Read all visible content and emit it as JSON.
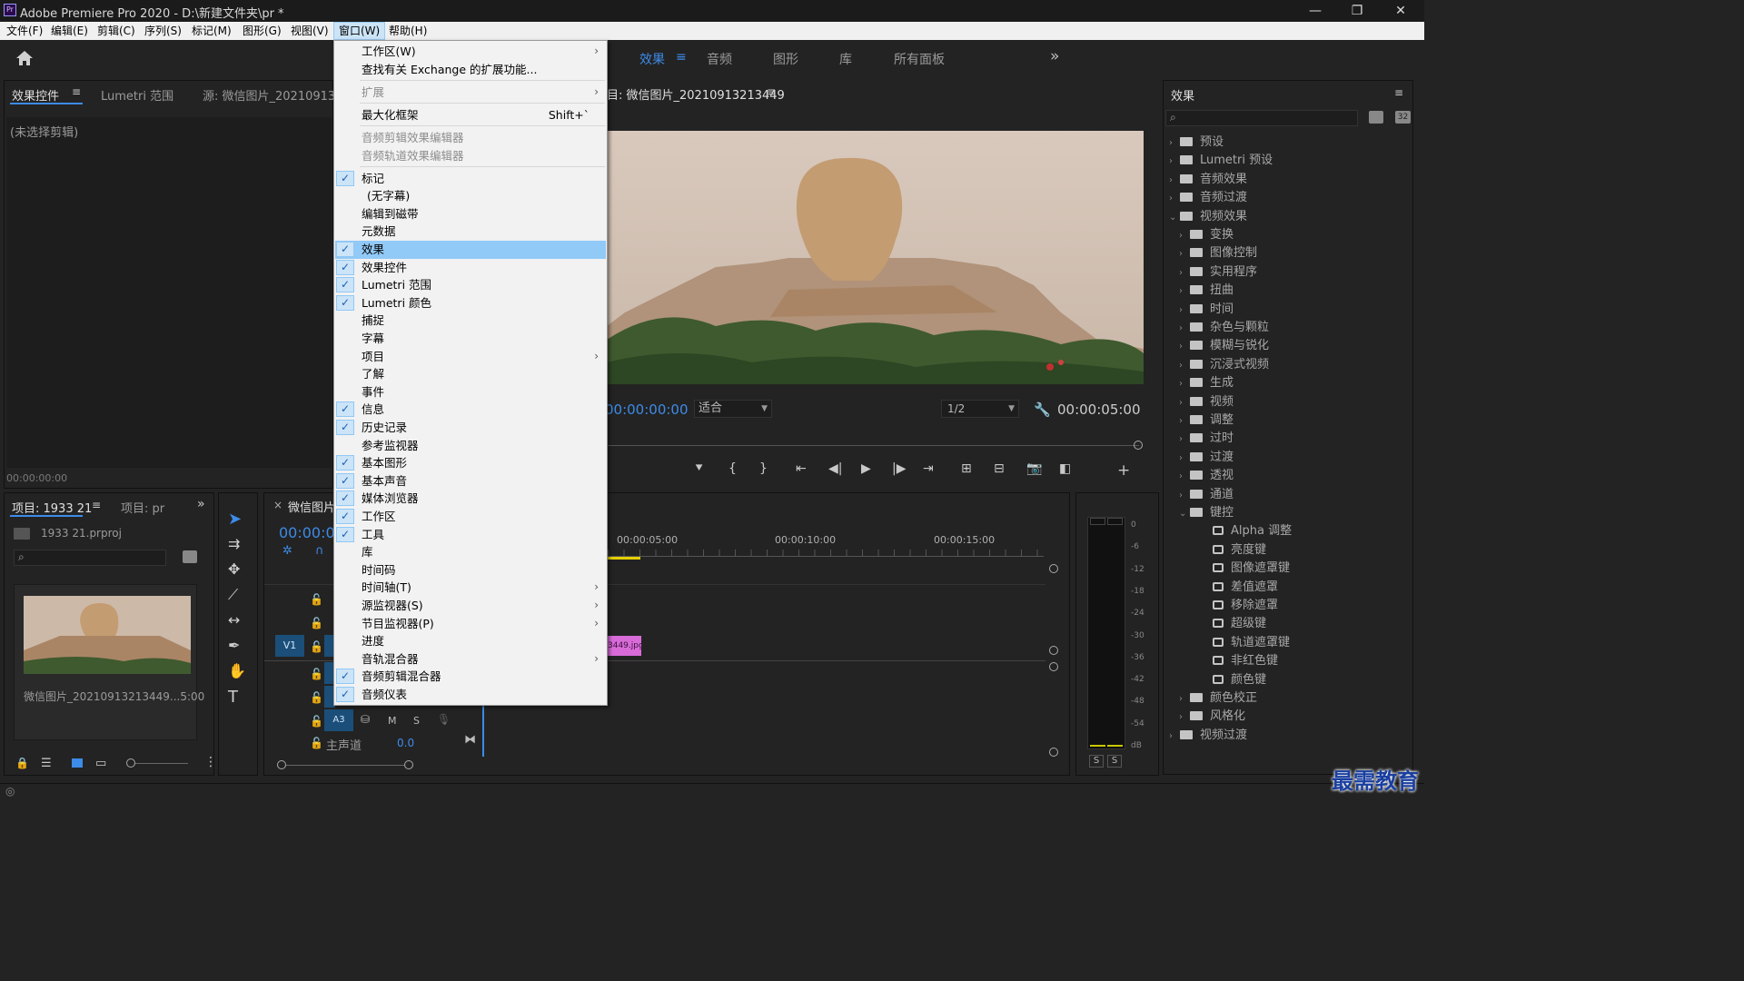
{
  "window": {
    "app_icon": "Pr",
    "title": "Adobe Premiere Pro 2020 - D:\\新建文件夹\\pr *",
    "min": "—",
    "max": "❐",
    "close": "✕"
  },
  "menubar": {
    "items": [
      "文件(F)",
      "编辑(E)",
      "剪辑(C)",
      "序列(S)",
      "标记(M)",
      "图形(G)",
      "视图(V)",
      "窗口(W)",
      "帮助(H)"
    ]
  },
  "workspace": {
    "tabs": [
      "效果",
      "音频",
      "图形",
      "库",
      "所有面板"
    ],
    "active": "效果",
    "more": "»"
  },
  "effect_controls": {
    "tabs": [
      "效果控件",
      "Lumetri 范围",
      "源: 微信图片_2021091321"
    ],
    "empty": "(未选择剪辑)",
    "timecode": "00:00:00:00"
  },
  "program": {
    "title": "目: 微信图片_20210913213449",
    "timecode_left": "00:00:00:00",
    "fit": "适合",
    "quality": "1/2",
    "timecode_right": "00:00:05:00"
  },
  "effects_panel": {
    "title": "效果",
    "items": [
      {
        "label": "预设",
        "level": 0,
        "kind": "bin",
        "open": false
      },
      {
        "label": "Lumetri 预设",
        "level": 0,
        "kind": "bin",
        "open": false
      },
      {
        "label": "音频效果",
        "level": 0,
        "kind": "folder",
        "open": false
      },
      {
        "label": "音频过渡",
        "level": 0,
        "kind": "folder",
        "open": false
      },
      {
        "label": "视频效果",
        "level": 0,
        "kind": "folder",
        "open": true
      },
      {
        "label": "变换",
        "level": 1,
        "kind": "folder",
        "open": false
      },
      {
        "label": "图像控制",
        "level": 1,
        "kind": "folder",
        "open": false
      },
      {
        "label": "实用程序",
        "level": 1,
        "kind": "folder",
        "open": false
      },
      {
        "label": "扭曲",
        "level": 1,
        "kind": "folder",
        "open": false
      },
      {
        "label": "时间",
        "level": 1,
        "kind": "folder",
        "open": false
      },
      {
        "label": "杂色与颗粒",
        "level": 1,
        "kind": "folder",
        "open": false
      },
      {
        "label": "模糊与锐化",
        "level": 1,
        "kind": "folder",
        "open": false
      },
      {
        "label": "沉浸式视频",
        "level": 1,
        "kind": "folder",
        "open": false
      },
      {
        "label": "生成",
        "level": 1,
        "kind": "folder",
        "open": false
      },
      {
        "label": "视频",
        "level": 1,
        "kind": "folder",
        "open": false
      },
      {
        "label": "调整",
        "level": 1,
        "kind": "folder",
        "open": false
      },
      {
        "label": "过时",
        "level": 1,
        "kind": "folder",
        "open": false
      },
      {
        "label": "过渡",
        "level": 1,
        "kind": "folder",
        "open": false
      },
      {
        "label": "透视",
        "level": 1,
        "kind": "folder",
        "open": false
      },
      {
        "label": "通道",
        "level": 1,
        "kind": "folder",
        "open": false
      },
      {
        "label": "键控",
        "level": 1,
        "kind": "folder",
        "open": true
      },
      {
        "label": "Alpha 调整",
        "level": 2,
        "kind": "effect"
      },
      {
        "label": "亮度键",
        "level": 2,
        "kind": "effect"
      },
      {
        "label": "图像遮罩键",
        "level": 2,
        "kind": "effect"
      },
      {
        "label": "差值遮罩",
        "level": 2,
        "kind": "effect"
      },
      {
        "label": "移除遮罩",
        "level": 2,
        "kind": "effect"
      },
      {
        "label": "超级键",
        "level": 2,
        "kind": "effect"
      },
      {
        "label": "轨道遮罩键",
        "level": 2,
        "kind": "effect"
      },
      {
        "label": "非红色键",
        "level": 2,
        "kind": "effect"
      },
      {
        "label": "颜色键",
        "level": 2,
        "kind": "effect"
      },
      {
        "label": "颜色校正",
        "level": 1,
        "kind": "folder",
        "open": false
      },
      {
        "label": "风格化",
        "level": 1,
        "kind": "folder",
        "open": false
      },
      {
        "label": "视频过渡",
        "level": 0,
        "kind": "folder",
        "open": false
      }
    ]
  },
  "project": {
    "tabs": [
      "项目: 1933 21",
      "项目: pr"
    ],
    "file": "1933 21.prproj",
    "clip": "微信图片_20210913213449...5:00"
  },
  "timeline": {
    "tab": "微信图片",
    "timecode": "00:00:0",
    "ruler": [
      "00:00:05:00",
      "00:00:10:00",
      "00:00:15:00"
    ],
    "v1": "V1",
    "a3": "A3",
    "master": "主声道",
    "master_val": "0.0",
    "clip": "3449.jpg",
    "m": "M",
    "s": "S"
  },
  "meter": {
    "scale": [
      "0",
      "-6",
      "-12",
      "-18",
      "-24",
      "-30",
      "-36",
      "-42",
      "-48",
      "-54",
      "dB"
    ],
    "s1": "S",
    "s2": "S"
  },
  "context_menu": {
    "items": [
      {
        "label": "工作区(W)",
        "checked": false,
        "submenu": true
      },
      {
        "label": "查找有关 Exchange 的扩展功能...",
        "checked": false
      },
      {
        "sep": true
      },
      {
        "label": "扩展",
        "checked": false,
        "submenu": true,
        "disabled": true
      },
      {
        "sep": true
      },
      {
        "label": "最大化框架",
        "checked": false,
        "shortcut": "Shift+`"
      },
      {
        "sep": true
      },
      {
        "label": "音频剪辑效果编辑器",
        "checked": false,
        "disabled": true
      },
      {
        "label": "音频轨道效果编辑器",
        "checked": false,
        "disabled": true
      },
      {
        "sep": true
      },
      {
        "label": "标记",
        "checked": true
      },
      {
        "label": "(无字幕)",
        "checked": false,
        "indent": true
      },
      {
        "label": "编辑到磁带",
        "checked": false
      },
      {
        "label": "元数据",
        "checked": false
      },
      {
        "label": "效果",
        "checked": true,
        "highlighted": true
      },
      {
        "label": "效果控件",
        "checked": true
      },
      {
        "label": "Lumetri 范围",
        "checked": true
      },
      {
        "label": "Lumetri 颜色",
        "checked": true
      },
      {
        "label": "捕捉",
        "checked": false
      },
      {
        "label": "字幕",
        "checked": false
      },
      {
        "label": "项目",
        "checked": false,
        "submenu": true
      },
      {
        "label": "了解",
        "checked": false
      },
      {
        "label": "事件",
        "checked": false
      },
      {
        "label": "信息",
        "checked": true
      },
      {
        "label": "历史记录",
        "checked": true
      },
      {
        "label": "参考监视器",
        "checked": false
      },
      {
        "label": "基本图形",
        "checked": true
      },
      {
        "label": "基本声音",
        "checked": true
      },
      {
        "label": "媒体浏览器",
        "checked": true
      },
      {
        "label": "工作区",
        "checked": true
      },
      {
        "label": "工具",
        "checked": true
      },
      {
        "label": "库",
        "checked": false
      },
      {
        "label": "时间码",
        "checked": false
      },
      {
        "label": "时间轴(T)",
        "checked": false,
        "submenu": true
      },
      {
        "label": "源监视器(S)",
        "checked": false,
        "submenu": true
      },
      {
        "label": "节目监视器(P)",
        "checked": false,
        "submenu": true
      },
      {
        "label": "进度",
        "checked": false
      },
      {
        "label": "音轨混合器",
        "checked": false,
        "submenu": true
      },
      {
        "label": "音频剪辑混合器",
        "checked": true
      },
      {
        "label": "音频仪表",
        "checked": true
      }
    ]
  },
  "watermark": "最需教育",
  "colors": {
    "accent": "#3d8be8",
    "menu_highlight": "#91c9f7",
    "panel": "#232323"
  }
}
